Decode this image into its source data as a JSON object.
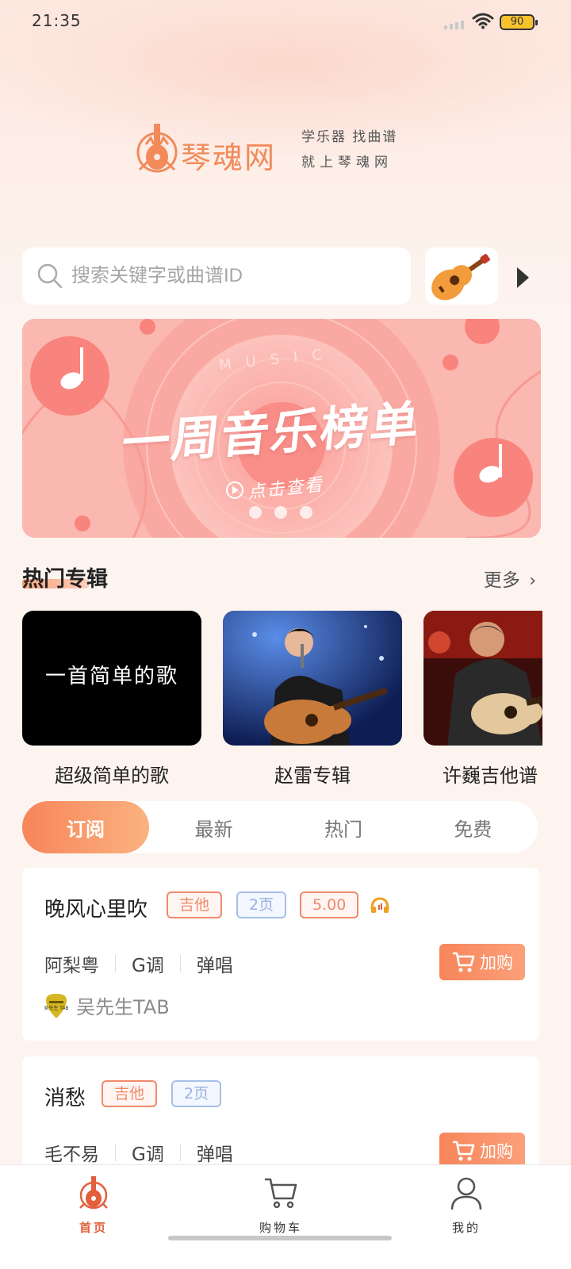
{
  "status_bar": {
    "time": "21:35",
    "battery": "90"
  },
  "brand": {
    "name": "琴魂网",
    "slogan_line1": "学乐器 找曲谱",
    "slogan_line2": "就上琴魂网"
  },
  "search": {
    "placeholder": "搜索关键字或曲谱ID"
  },
  "banner": {
    "music_label": "MUSIC",
    "title": "一周音乐榜单",
    "cta": "点击查看",
    "slide_count": 3
  },
  "hot_albums": {
    "title": "热门专辑",
    "more": "更多",
    "items": [
      {
        "name": "超级简单的歌",
        "cover_text": "一首简单的歌"
      },
      {
        "name": "赵雷专辑"
      },
      {
        "name": "许巍吉他谱"
      }
    ]
  },
  "tabs": [
    {
      "label": "订阅",
      "active": true
    },
    {
      "label": "最新",
      "active": false
    },
    {
      "label": "热门",
      "active": false
    },
    {
      "label": "免费",
      "active": false
    }
  ],
  "sheets": [
    {
      "title": "晚风心里吹",
      "instrument": "吉他",
      "pages": "2页",
      "price": "5.00",
      "has_audio": true,
      "artist": "阿梨粤",
      "key": "G调",
      "type": "弹唱",
      "cart_label": "加购",
      "author": "吴先生TAB",
      "author_badge": "吴先生 TAB"
    },
    {
      "title": "消愁",
      "instrument": "吉他",
      "pages": "2页",
      "artist": "毛不易",
      "key": "G调",
      "type": "弹唱",
      "cart_label": "加购"
    }
  ],
  "bottom_nav": [
    {
      "label": "首页",
      "active": true
    },
    {
      "label": "购物车",
      "active": false
    },
    {
      "label": "我的",
      "active": false
    }
  ],
  "colors": {
    "accent": "#f7855a",
    "brand": "#f28a5a",
    "active_nav": "#e35f3c",
    "tag_blue": "#a8bfe8"
  }
}
